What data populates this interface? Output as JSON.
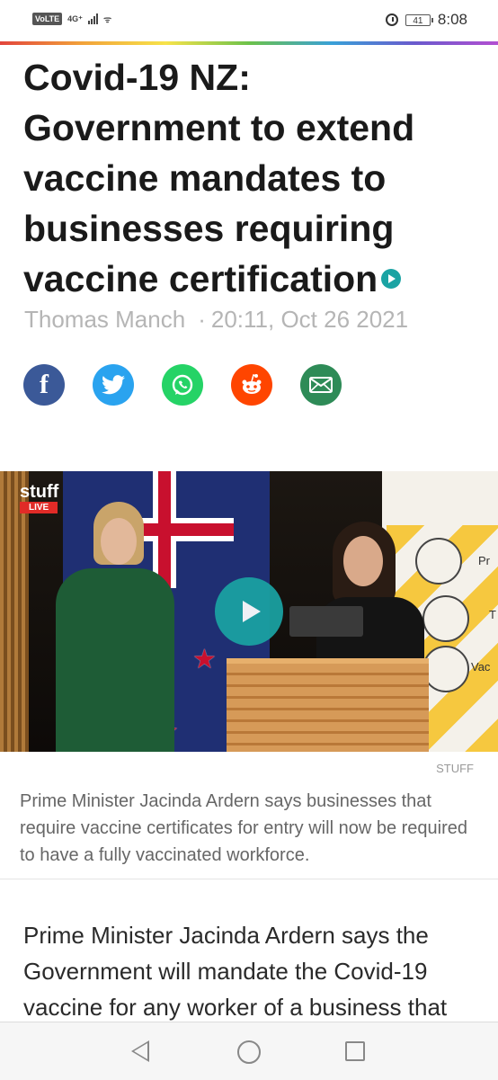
{
  "status_bar": {
    "volte": "VoLTE",
    "network": "4G⁺",
    "battery": "41",
    "time": "8:08"
  },
  "article": {
    "title": "Covid-19 NZ: Government to extend vaccine mandates to businesses requiring vaccine certification",
    "author": "Thomas Manch",
    "separator": "·",
    "date": "20:11, Oct 26 2021"
  },
  "share_icons": [
    "facebook-icon",
    "twitter-icon",
    "whatsapp-icon",
    "reddit-icon",
    "email-icon"
  ],
  "video": {
    "logo": "stuff",
    "live_label": "LIVE",
    "poster_words": [
      "Pr",
      "T",
      "Vac"
    ]
  },
  "media": {
    "credit": "STUFF",
    "caption": "Prime Minister Jacinda Ardern says businesses that require vaccine certificates for entry will now be required to have a fully vaccinated workforce."
  },
  "body": {
    "paragraph": "Prime Minister Jacinda Ardern says the Government will mandate the Covid-19 vaccine for any worker of a business that"
  },
  "colors": {
    "accent": "#1aa3a3",
    "facebook": "#3b5998",
    "twitter": "#2aa3ef",
    "whatsapp": "#25d366",
    "reddit": "#ff4500",
    "email": "#2e8b57"
  }
}
